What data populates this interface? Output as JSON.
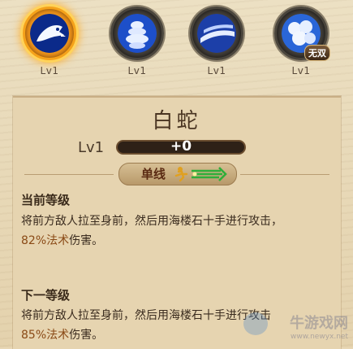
{
  "skills": [
    {
      "level": "Lv1",
      "icon": "white-snake-icon",
      "selected": true
    },
    {
      "level": "Lv1",
      "icon": "smoke-tornado-icon",
      "selected": false
    },
    {
      "level": "Lv1",
      "icon": "smoke-wave-icon",
      "selected": false
    },
    {
      "level": "Lv1",
      "icon": "smoke-cloud-icon",
      "selected": false,
      "badge": "无双"
    }
  ],
  "detail": {
    "name": "白蛇",
    "level_label": "Lv1",
    "xp_text": "+0",
    "xp_progress": 0.0,
    "type_label": "单线"
  },
  "current": {
    "title": "当前等级",
    "line1": "将前方敌人拉至身前，然后用海楼石十手进行攻击，",
    "pct": "82%法术",
    "tail": "伤害。"
  },
  "next": {
    "title": "下一等级",
    "line1": "将前方敌人拉至身前，然后用海楼石十手进行攻击",
    "pct": "85%法术",
    "tail": "伤害。"
  },
  "watermark": {
    "brand": "牛游戏网",
    "url": "www.newyx.net"
  },
  "colors": {
    "selected_glow": "#ffb52e",
    "percent_text": "#8a4a16"
  }
}
